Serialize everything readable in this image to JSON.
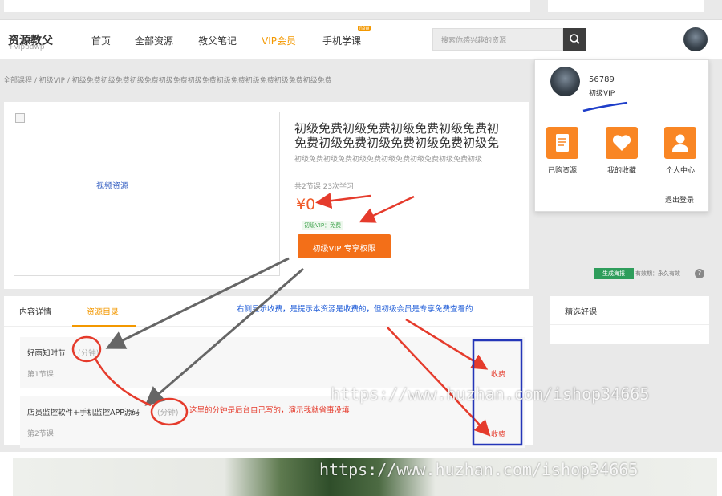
{
  "header": {
    "logo_main": "资源教父",
    "logo_sub": "+vipbdwp",
    "nav": [
      {
        "label": "首页"
      },
      {
        "label": "全部资源"
      },
      {
        "label": "教父笔记"
      },
      {
        "label": "VIP会员"
      },
      {
        "label": "手机学课"
      }
    ],
    "hot_badge": "new",
    "search_placeholder": "搜索你感兴趣的资源"
  },
  "breadcrumb": "全部课程 / 初级VIP / 初级免费初级免费初级免费初级免费初级免费初级免费初级免费初级免费初级免费",
  "resource": {
    "thumb_label": "视频资源",
    "title_line1": "初级免费初级免费初级免费初级免费初",
    "title_line2": "免费初级免费初级免费初级免费初级免",
    "subtitle": "初级免费初级免费初级免费初级免费初级免费初级免费初级",
    "meta": "共2节课 23次学习",
    "price": "¥0",
    "vip_tag": "初级VIP：免费",
    "vip_button": "初级VIP 专享权限",
    "poster_button": "生成海报",
    "valid": "有效期：永久有效",
    "help": "?"
  },
  "dropdown": {
    "user_id": "56789",
    "level": "初级VIP",
    "items": [
      {
        "label": "已购资源",
        "icon": "document-icon"
      },
      {
        "label": "我的收藏",
        "icon": "heart-icon"
      },
      {
        "label": "个人中心",
        "icon": "user-icon"
      }
    ],
    "logout": "退出登录"
  },
  "tabs": [
    {
      "label": "内容详情"
    },
    {
      "label": "资源目录"
    }
  ],
  "annotation_note": "右侧显示收费，是提示本资源是收费的，但初级会员是专享免费查看的",
  "lessons": [
    {
      "title": "好雨知时节",
      "unit": "(分钟)",
      "index": "第1节课",
      "fee": "收费"
    },
    {
      "title": "店员监控软件+手机监控APP源码",
      "unit": "(分钟)",
      "index": "第2节课",
      "fee": "收费"
    }
  ],
  "red_note": "这里的分钟是后台自己写的，演示我就省事没填",
  "sidebar": {
    "title": "精选好课"
  },
  "watermark": "https://www.huzhan.com/ishop34665",
  "colors": {
    "accent": "#f39800",
    "button": "#f36f18",
    "price": "#f05a28",
    "annotation_red": "#e53b2c",
    "annotation_blue": "#1e5bd7"
  }
}
